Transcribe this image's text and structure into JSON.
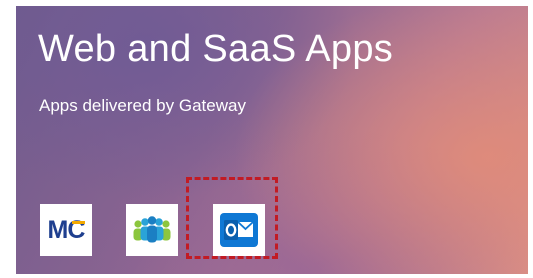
{
  "tile": {
    "title": "Web and SaaS Apps",
    "subtitle": "Apps delivered by Gateway"
  },
  "apps": [
    {
      "icon": "mc-logo-icon",
      "text": "MC"
    },
    {
      "icon": "people-group-icon"
    },
    {
      "icon": "outlook-icon",
      "highlighted": true
    }
  ],
  "colors": {
    "highlight_border": "#c21b24",
    "mc_blue": "#1f3f8f",
    "mc_accent": "#f2a900",
    "outlook_blue": "#0f78d4",
    "people_green": "#8cc63e",
    "people_blue": "#2aa3d8"
  }
}
